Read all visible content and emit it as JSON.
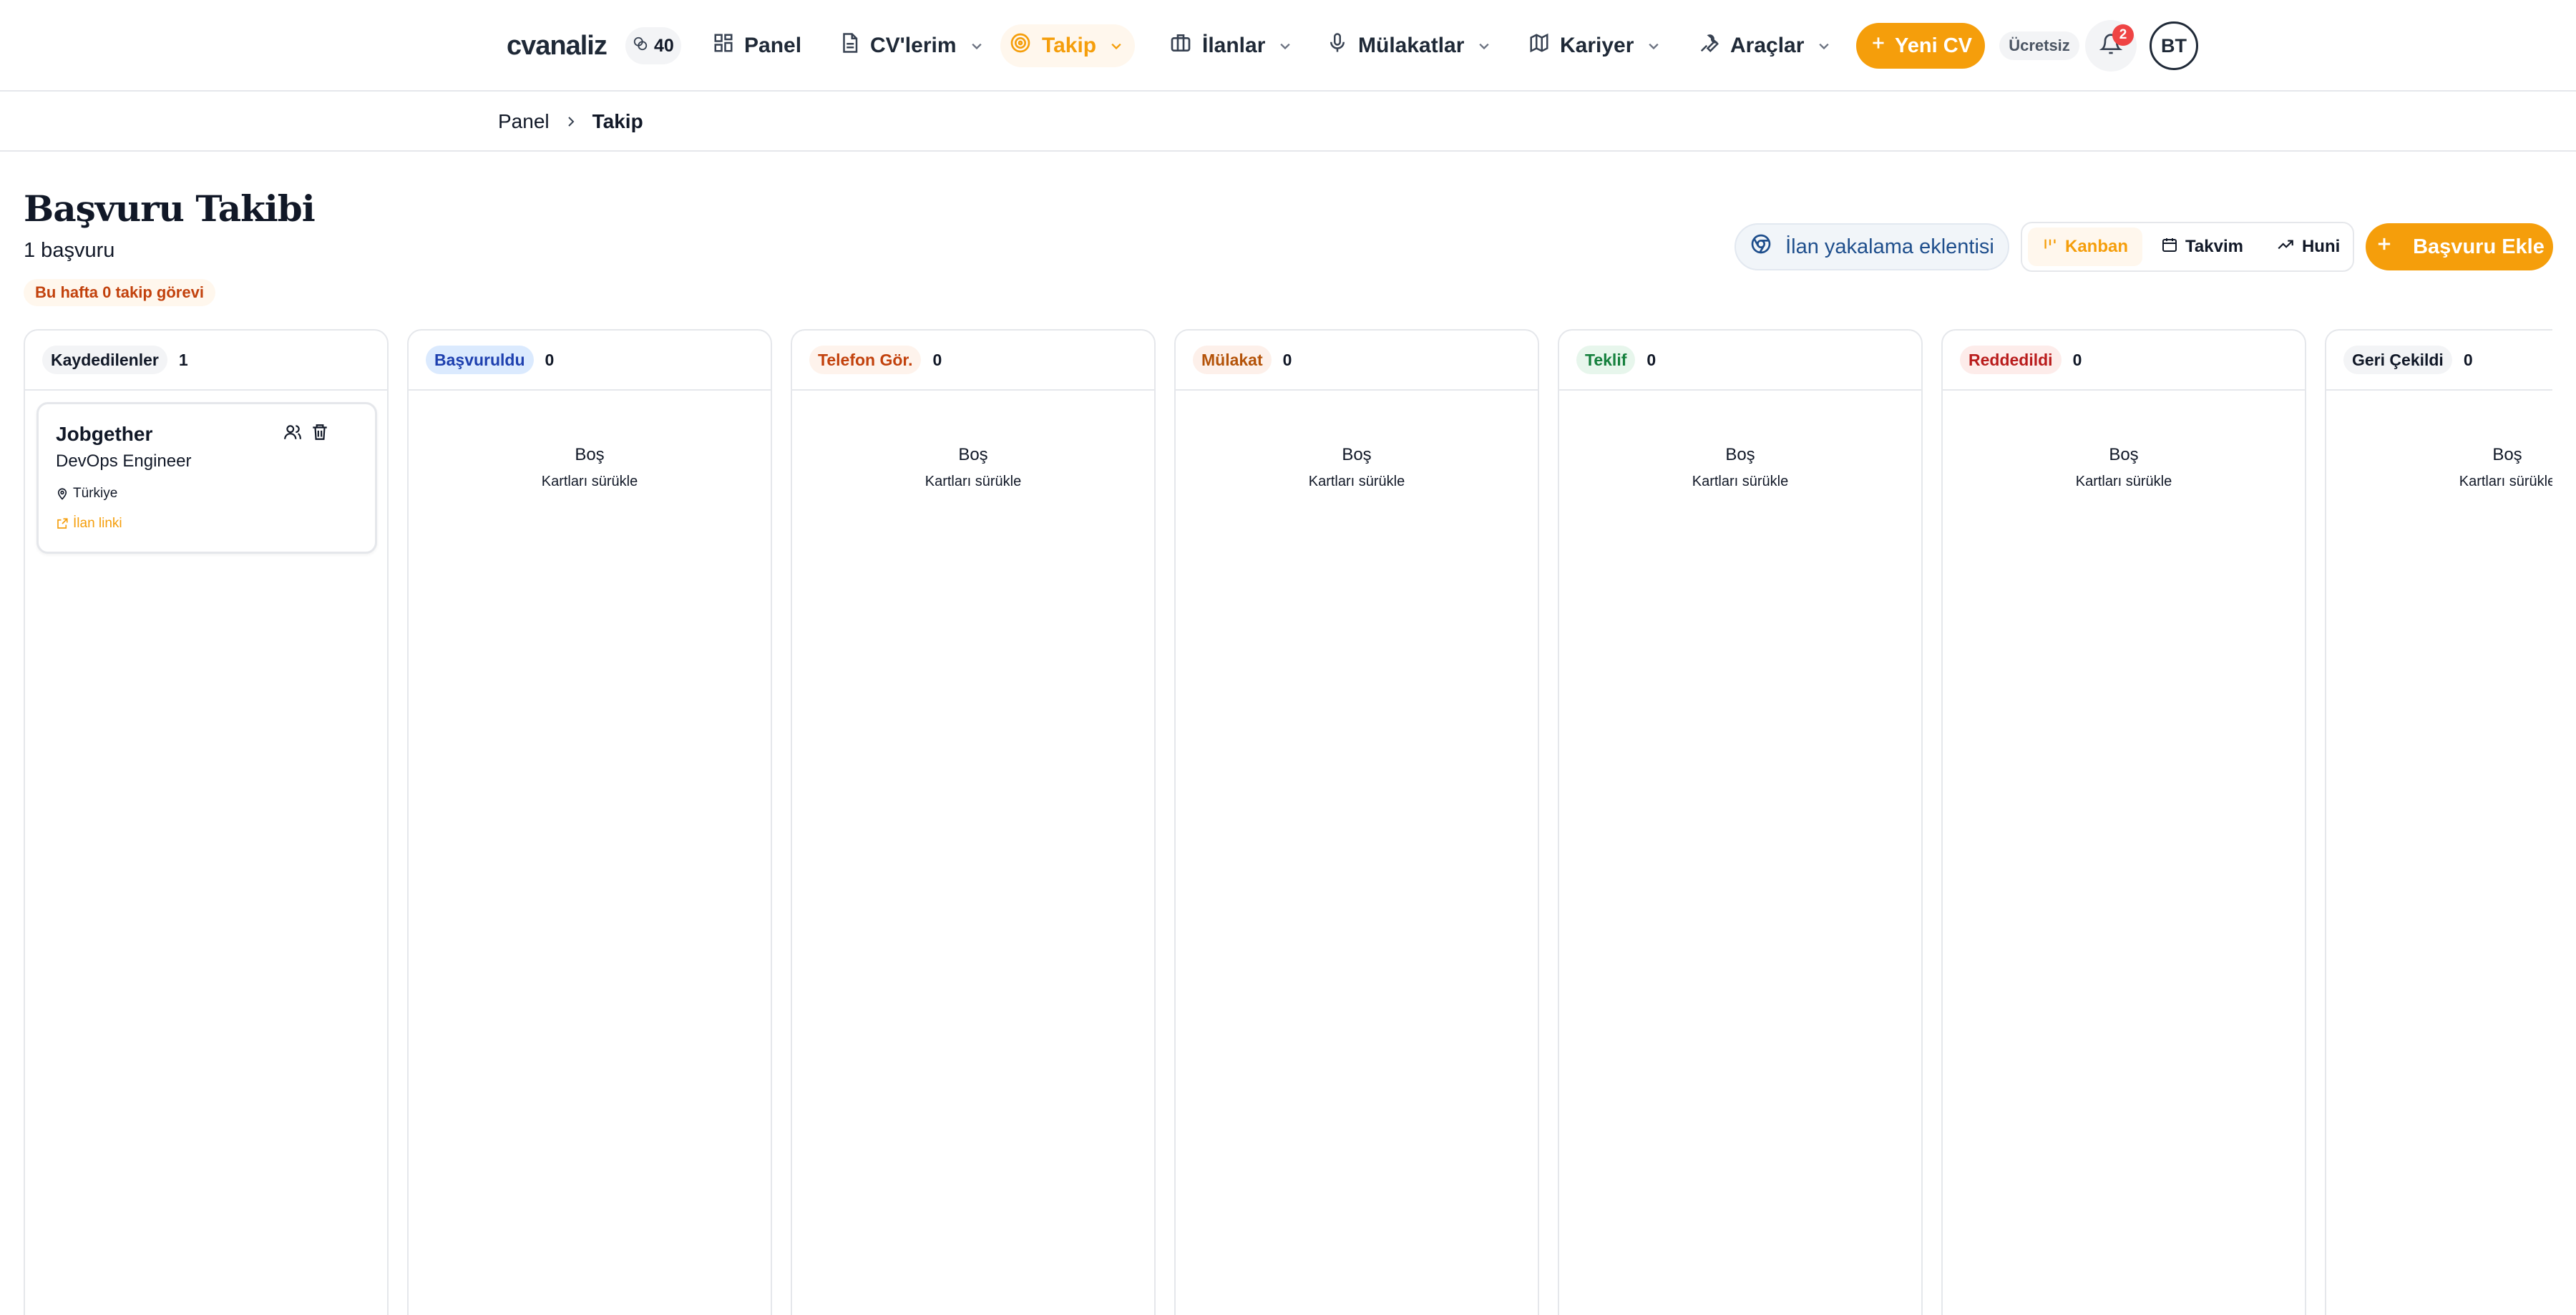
{
  "nav": {
    "logo": "cvanaliz",
    "credits": "40",
    "items": [
      {
        "label": "Panel",
        "icon": "grid-icon",
        "chevron": false
      },
      {
        "label": "CV'lerim",
        "icon": "document-icon",
        "chevron": true
      },
      {
        "label": "Takip",
        "icon": "target-icon",
        "chevron": true,
        "active": true
      },
      {
        "label": "İlanlar",
        "icon": "briefcase-icon",
        "chevron": true
      },
      {
        "label": "Mülakatlar",
        "icon": "microphone-icon",
        "chevron": true
      },
      {
        "label": "Kariyer",
        "icon": "map-icon",
        "chevron": true
      },
      {
        "label": "Araçlar",
        "icon": "wrench-icon",
        "chevron": true
      }
    ],
    "new_cv_label": "Yeni CV",
    "plan_badge": "Ücretsiz",
    "notification_count": "2",
    "avatar_initials": "BT"
  },
  "breadcrumb": {
    "items": [
      "Panel",
      "Takip"
    ]
  },
  "header": {
    "title": "Başvuru Takibi",
    "count_text": "1 başvuru",
    "task_badge": "Bu hafta 0 takip görevi",
    "extension_label": "İlan yakalama eklentisi",
    "views": [
      {
        "label": "Kanban",
        "icon": "kanban-icon",
        "active": true
      },
      {
        "label": "Takvim",
        "icon": "calendar-icon",
        "active": false
      },
      {
        "label": "Huni",
        "icon": "trend-icon",
        "active": false
      }
    ],
    "add_label": "Başvuru Ekle"
  },
  "colors": {
    "accent": "#f59e0b",
    "accent_soft": "#fff7ed"
  },
  "board": {
    "empty_title": "Boş",
    "empty_hint": "Kartları sürükle",
    "columns": [
      {
        "label": "Kaydedilenler",
        "count": "1",
        "bg": "#f3f4f6",
        "fg": "#111827"
      },
      {
        "label": "Başvuruldu",
        "count": "0",
        "bg": "#dbeafe",
        "fg": "#1e40af"
      },
      {
        "label": "Telefon Gör.",
        "count": "0",
        "bg": "#fef3ec",
        "fg": "#c2410c"
      },
      {
        "label": "Mülakat",
        "count": "0",
        "bg": "#fdf0ea",
        "fg": "#b45309"
      },
      {
        "label": "Teklif",
        "count": "0",
        "bg": "#e7f6ec",
        "fg": "#15803d"
      },
      {
        "label": "Reddedildi",
        "count": "0",
        "bg": "#fdecea",
        "fg": "#b91c1c"
      },
      {
        "label": "Geri Çekildi",
        "count": "0",
        "bg": "#f3f4f6",
        "fg": "#111827"
      }
    ],
    "card": {
      "company": "Jobgether",
      "role": "DevOps Engineer",
      "location": "Türkiye",
      "link_label": "İlan linki"
    }
  }
}
